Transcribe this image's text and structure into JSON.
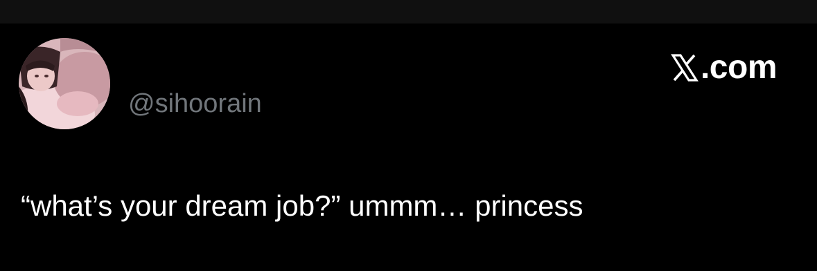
{
  "header": {
    "handle": "@sihoorain",
    "brand_suffix": ".com",
    "brand_icon": "x-logo-icon"
  },
  "tweet": {
    "text": "“what’s your dream job?” ummm… princess"
  },
  "colors": {
    "background": "#000000",
    "top_bar": "#101010",
    "handle": "#71767b",
    "text": "#ffffff"
  },
  "avatar": {
    "icon": "profile-photo"
  }
}
